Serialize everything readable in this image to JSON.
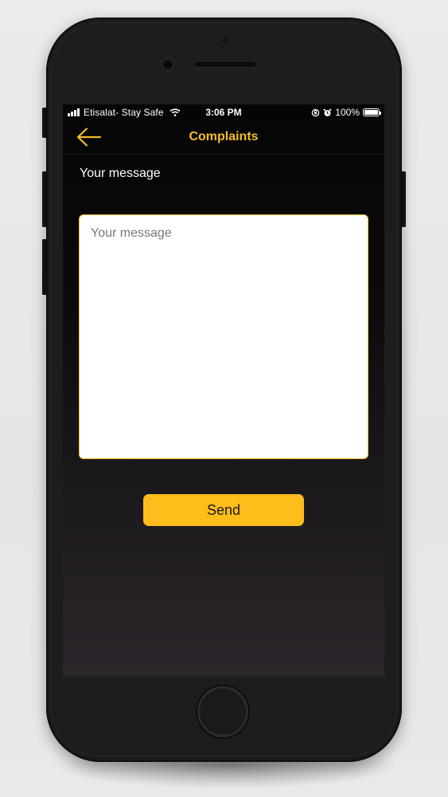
{
  "status_bar": {
    "carrier": "Etisalat- Stay Safe",
    "time": "3:06 PM",
    "battery": "100%",
    "battery_level": 1.0,
    "icons": [
      "signal-icon",
      "wifi-icon",
      "orientation-lock-icon",
      "alarm-icon",
      "battery-icon"
    ]
  },
  "nav": {
    "back_icon": "arrow-left-icon",
    "title": "Complaints"
  },
  "form": {
    "label": "Your message",
    "message_value": "",
    "message_placeholder": "Your message",
    "send_label": "Send"
  },
  "colors": {
    "accent": "#f6bd2b",
    "button": "#fdbd1b",
    "screen_bg": "#050505",
    "input_bg": "#ffffff"
  }
}
